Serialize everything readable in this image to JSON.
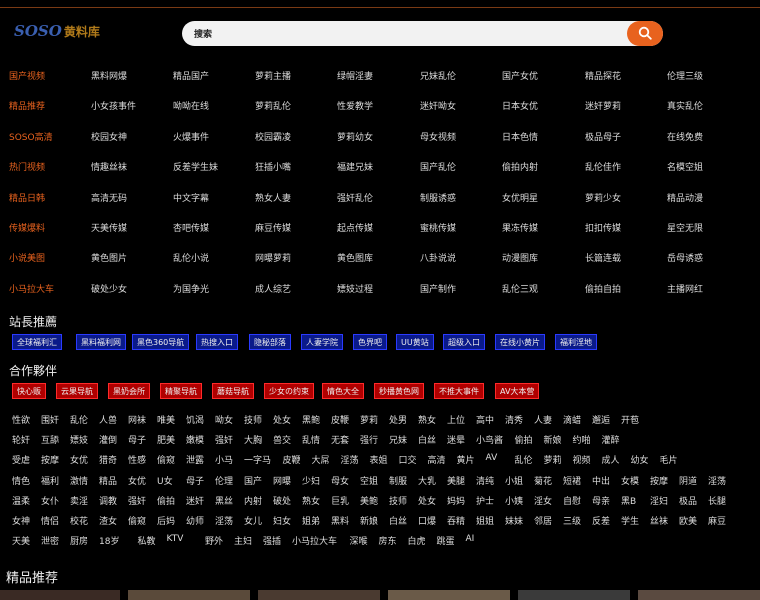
{
  "logo": {
    "en": "SOSO",
    "cn": "黄料库"
  },
  "search": {
    "placeholder": "搜索"
  },
  "nav": [
    {
      "head": "国产视频",
      "items": [
        "黑料网爆",
        "精品国产",
        "萝莉主播",
        "绿帽淫妻",
        "兄妹乱伦",
        "国产女优",
        "精品探花",
        "伦理三级"
      ]
    },
    {
      "head": "精品推荐",
      "items": [
        "小女孩事件",
        "呦呦在线",
        "萝莉乱伦",
        "性爱教学",
        "迷奸呦女",
        "日本女优",
        "迷奸萝莉",
        "真实乱伦"
      ]
    },
    {
      "head": "SOSO高清",
      "items": [
        "校园女神",
        "火爆事件",
        "校园霸凌",
        "萝莉幼女",
        "母女视频",
        "日本色情",
        "极品母子",
        "在线免费"
      ]
    },
    {
      "head": "热门视频",
      "items": [
        "情趣丝袜",
        "反差学生妹",
        "狂插小嘴",
        "福建兄妹",
        "国产乱伦",
        "偷拍内射",
        "乱伦佳作",
        "名模空姐"
      ]
    },
    {
      "head": "精品日韩",
      "items": [
        "高清无码",
        "中文字幕",
        "熟女人妻",
        "强奸乱伦",
        "制服诱惑",
        "女优明星",
        "萝莉少女",
        "精品动漫"
      ]
    },
    {
      "head": "传媒爆料",
      "items": [
        "天美传媒",
        "杏吧传媒",
        "麻豆传媒",
        "起点传媒",
        "蜜桃传媒",
        "果冻传媒",
        "扣扣传媒",
        "星空无限"
      ]
    },
    {
      "head": "小说美图",
      "items": [
        "黄色图片",
        "乱伦小说",
        "网曝萝莉",
        "黄色图库",
        "八卦说说",
        "动漫图库",
        "长篇连载",
        "岳母诱惑"
      ]
    },
    {
      "head": "小马拉大车",
      "items": [
        "破处少女",
        "为国争光",
        "成人综艺",
        "嫖妓过程",
        "国产制作",
        "乱伦三观",
        "偷拍自拍",
        "主播网红"
      ]
    }
  ],
  "friends": {
    "title": "站長推薦",
    "links": [
      "全球福利汇",
      "黑料福利网",
      "黑色360导航",
      "热搜入口",
      "隐秘部落",
      "人妻学院",
      "色界吧",
      "UU黄站",
      "超级入口",
      "在线小黄片",
      "福利淫地"
    ]
  },
  "partners": {
    "title": "合作夥伴",
    "links": [
      "快心贩",
      "云果导航",
      "黑奶会所",
      "精聚导航",
      "蘑菇导航",
      "少女の约束",
      "情色大全",
      "秒播黄色网",
      "不推大事件",
      "AV大本营"
    ]
  },
  "tags": [
    [
      "性欲",
      "围奸",
      "乱伦",
      "人兽",
      "网袜",
      "唯美",
      "饥渴",
      "呦女",
      "技师",
      "处女",
      "黑鲍",
      "皮鞭",
      "萝莉",
      "处男",
      "熟女",
      "上位",
      "高中",
      "清秀",
      "人妻",
      "滴蜡",
      "邂逅",
      "开苞"
    ],
    [
      "轮奸",
      "互舔",
      "嫖妓",
      "灌倒",
      "母子",
      "肥美",
      "嫩模",
      "强奸",
      "大胸",
      "兽交",
      "乱情",
      "无套",
      "强行",
      "兄妹",
      "白丝",
      "迷晕",
      "小鸟酱",
      "偷拍",
      "新娘",
      "约啪",
      "灌醉"
    ],
    [
      "受虐",
      "按摩",
      "女优",
      "猎奇",
      "性感",
      "偷窥",
      "泄露",
      "小马",
      "一字马",
      "皮鞭",
      "大屌",
      "淫荡",
      "表姐",
      "口交",
      "高清",
      "黄片",
      "AV",
      "乱伦",
      "萝莉",
      "视频",
      "成人",
      "幼女",
      "毛片"
    ],
    [
      "情色",
      "福利",
      "激情",
      "精品",
      "女优",
      "U女",
      "母子",
      "伦理",
      "国产",
      "网曝",
      "少妇",
      "母女",
      "空姐",
      "制服",
      "大乳",
      "美腿",
      "清纯",
      "小姐",
      "菊花",
      "短裙",
      "中出",
      "女模",
      "按摩",
      "阴道",
      "淫荡"
    ],
    [
      "温柔",
      "女仆",
      "卖淫",
      "调教",
      "强奸",
      "偷拍",
      "迷奸",
      "黑丝",
      "内射",
      "破处",
      "熟女",
      "巨乳",
      "美鲍",
      "技师",
      "处女",
      "妈妈",
      "护士",
      "小姨",
      "淫女",
      "自慰",
      "母亲",
      "黑B",
      "淫妇",
      "极品",
      "长腿"
    ],
    [
      "女神",
      "情侣",
      "校花",
      "渣女",
      "偷窥",
      "后妈",
      "幼师",
      "淫荡",
      "女儿",
      "妇女",
      "姐弟",
      "黑料",
      "新娘",
      "白丝",
      "口爆",
      "吞精",
      "姐姐",
      "妹妹",
      "邻居",
      "三级",
      "反差",
      "学生",
      "丝袜",
      "欧美",
      "麻豆"
    ],
    [
      "天美",
      "泄密",
      "厨房",
      "18岁",
      "私教",
      "KTV",
      "野外",
      "主妇",
      "强插",
      "小马拉大车",
      "深喉",
      "房东",
      "白虎",
      "跳蛋",
      "AI"
    ]
  ],
  "bottom": {
    "title": "精品推荐"
  }
}
